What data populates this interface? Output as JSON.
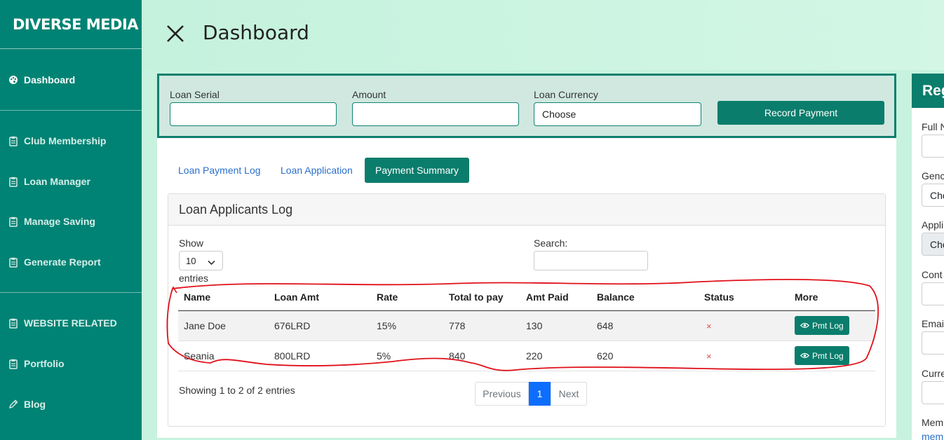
{
  "brand": "DIVERSE MEDIA",
  "sidebar": {
    "items": [
      {
        "label": "Dashboard",
        "icon": "palette-icon"
      },
      {
        "label": "Club Membership",
        "icon": "clipboard-icon"
      },
      {
        "label": "Loan Manager",
        "icon": "clipboard-icon"
      },
      {
        "label": "Manage Saving",
        "icon": "clipboard-icon"
      },
      {
        "label": "Generate Report",
        "icon": "clipboard-icon"
      },
      {
        "label": "WEBSITE RELATED",
        "icon": "clipboard-icon"
      },
      {
        "label": "Portfolio",
        "icon": "clipboard-icon"
      },
      {
        "label": "Blog",
        "icon": "pencil-icon"
      }
    ]
  },
  "header": {
    "title": "Dashboard"
  },
  "payment_form": {
    "loan_serial_label": "Loan Serial",
    "amount_label": "Amount",
    "currency_label": "Loan Currency",
    "currency_value": "Choose",
    "record_button": "Record Payment"
  },
  "tabs": [
    "Loan Payment Log",
    "Loan Application",
    "Payment Summary"
  ],
  "log": {
    "title": "Loan Applicants Log",
    "show_label": "Show",
    "page_length": "10",
    "entries_label": "entries",
    "search_label": "Search:",
    "columns": [
      "Name",
      "Loan Amt",
      "Rate",
      "Total to pay",
      "Amt Paid",
      "Balance",
      "Status",
      "More"
    ],
    "rows": [
      {
        "name": "Jane Doe",
        "loan_amt": "676LRD",
        "rate": "15%",
        "total": "778",
        "paid": "130",
        "balance": "648",
        "status": "×",
        "more": "Pmt Log"
      },
      {
        "name": "Seania",
        "loan_amt": "800LRD",
        "rate": "5%",
        "total": "840",
        "paid": "220",
        "balance": "620",
        "status": "×",
        "more": "Pmt Log"
      }
    ],
    "info": "Showing 1 to 2 of 2 entries",
    "pagination": {
      "previous": "Previous",
      "current": "1",
      "next": "Next"
    }
  },
  "right_panel": {
    "title": "Reg",
    "fields": [
      {
        "label": "Full N",
        "value": ""
      },
      {
        "label": "Genc",
        "value": "Cho"
      },
      {
        "label": "Appli",
        "value": "Cho"
      },
      {
        "label": "Cont",
        "value": ""
      },
      {
        "label": "Emai",
        "value": ""
      },
      {
        "label": "Curre",
        "value": ""
      }
    ],
    "footer_label": "Mem",
    "footer_link": "mem"
  },
  "colors": {
    "brand": "#008374",
    "accent": "#0b7d6c",
    "header_bg": "#c6f2df",
    "annotation": "#e0101a"
  }
}
